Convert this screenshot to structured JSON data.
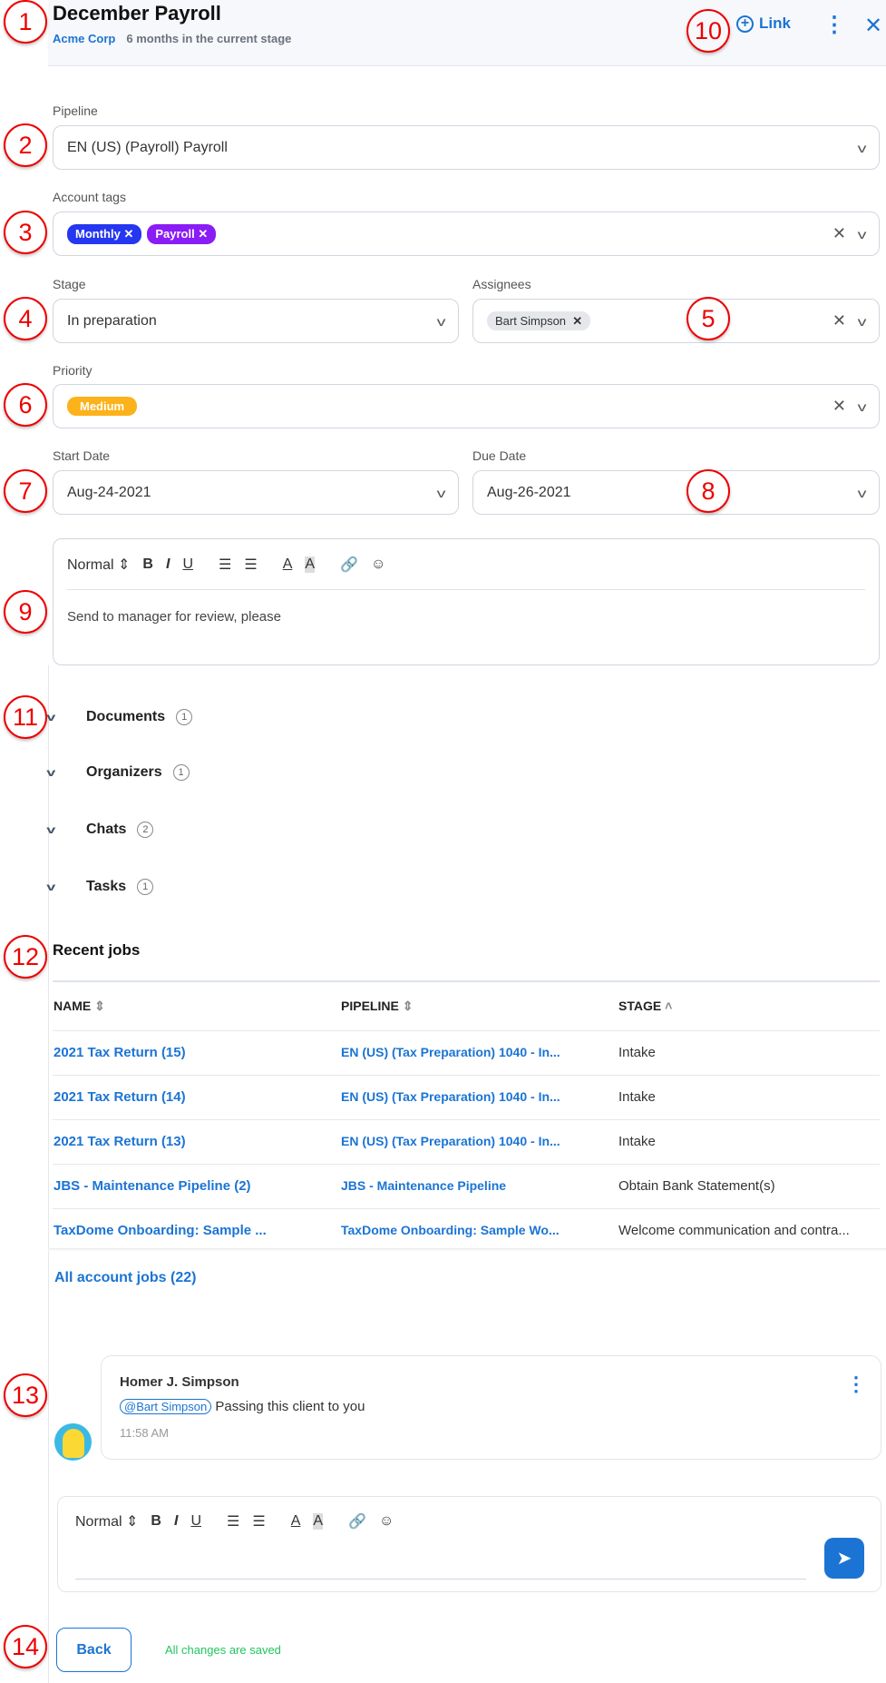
{
  "header": {
    "title": "December Payroll",
    "account": "Acme Corp",
    "stage_duration": "6 months in the current stage",
    "link_label": "Link"
  },
  "fields": {
    "pipeline": {
      "label": "Pipeline",
      "value": "EN (US) (Payroll) Payroll"
    },
    "account_tags": {
      "label": "Account tags",
      "tags": [
        {
          "label": "Monthly",
          "color": "#2537f0"
        },
        {
          "label": "Payroll",
          "color": "#8a1cf5"
        }
      ]
    },
    "stage": {
      "label": "Stage",
      "value": "In preparation"
    },
    "assignees": {
      "label": "Assignees",
      "values": [
        "Bart Simpson"
      ]
    },
    "priority": {
      "label": "Priority",
      "value": "Medium",
      "color": "#fbb21b"
    },
    "start_date": {
      "label": "Start Date",
      "value": "Aug-24-2021"
    },
    "due_date": {
      "label": "Due Date",
      "value": "Aug-26-2021"
    }
  },
  "editor": {
    "format": "Normal",
    "content": "Send to manager for review, please"
  },
  "sections": [
    {
      "label": "Documents",
      "count": "1"
    },
    {
      "label": "Organizers",
      "count": "1"
    },
    {
      "label": "Chats",
      "count": "2"
    },
    {
      "label": "Tasks",
      "count": "1"
    }
  ],
  "recent_jobs": {
    "title": "Recent jobs",
    "columns": [
      "NAME",
      "PIPELINE",
      "STAGE"
    ],
    "rows": [
      {
        "name": "2021 Tax Return (15)",
        "pipeline": "EN (US) (Tax Preparation) 1040 - In...",
        "stage": "Intake"
      },
      {
        "name": "2021 Tax Return (14)",
        "pipeline": "EN (US) (Tax Preparation) 1040 - In...",
        "stage": "Intake"
      },
      {
        "name": "2021 Tax Return (13)",
        "pipeline": "EN (US) (Tax Preparation) 1040 - In...",
        "stage": "Intake"
      },
      {
        "name": "JBS - Maintenance Pipeline (2)",
        "pipeline": "JBS - Maintenance Pipeline",
        "stage": "Obtain Bank Statement(s)"
      },
      {
        "name": "TaxDome Onboarding: Sample ...",
        "pipeline": "TaxDome Onboarding: Sample Wo...",
        "stage": "Welcome communication and contra..."
      }
    ],
    "all_link": "All account jobs (22)"
  },
  "comment": {
    "author": "Homer J. Simpson",
    "mention": "@Bart Simpson",
    "text": "Passing this client to you",
    "time": "11:58 AM"
  },
  "composer": {
    "format": "Normal"
  },
  "footer": {
    "back_label": "Back",
    "status": "All changes are saved"
  },
  "annotations": [
    "1",
    "2",
    "3",
    "4",
    "5",
    "6",
    "7",
    "8",
    "9",
    "10",
    "11",
    "12",
    "13",
    "14"
  ]
}
